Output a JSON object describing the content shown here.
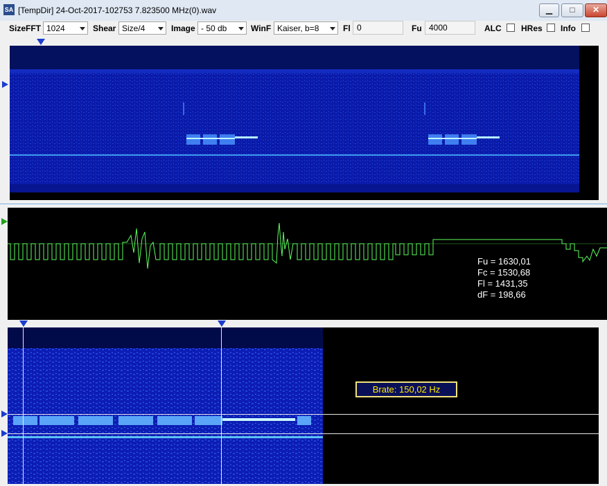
{
  "window": {
    "app_icon": "SA",
    "title": "[TempDir] 24-Oct-2017-102753 7.823500 MHz(0).wav",
    "minimize": "▁",
    "maximize": "□",
    "close": "✕"
  },
  "toolbar": {
    "sizefft_label": "SizeFFT",
    "sizefft_value": "1024",
    "shear_label": "Shear",
    "shear_value": "Size/4",
    "image_label": "Image",
    "image_value": "- 50 db",
    "winf_label": "WinF",
    "winf_value": "Kaiser, b=8",
    "fl_label": "Fl",
    "fl_value": "0",
    "fu_label": "Fu",
    "fu_value": "4000",
    "alc_label": "ALC",
    "hres_label": "HRes",
    "info_label": "Info"
  },
  "readout": {
    "fu": "Fu = 1630,01",
    "fc": "Fc = 1530,68",
    "fl": "Fl = 1431,35",
    "df": "dF = 198,66"
  },
  "brate": "Brate: 150,02 Hz",
  "colors": {
    "spectrogram_bg": "#0a1db0",
    "waveform": "#5cff5c",
    "marker": "#1a3ccf"
  }
}
